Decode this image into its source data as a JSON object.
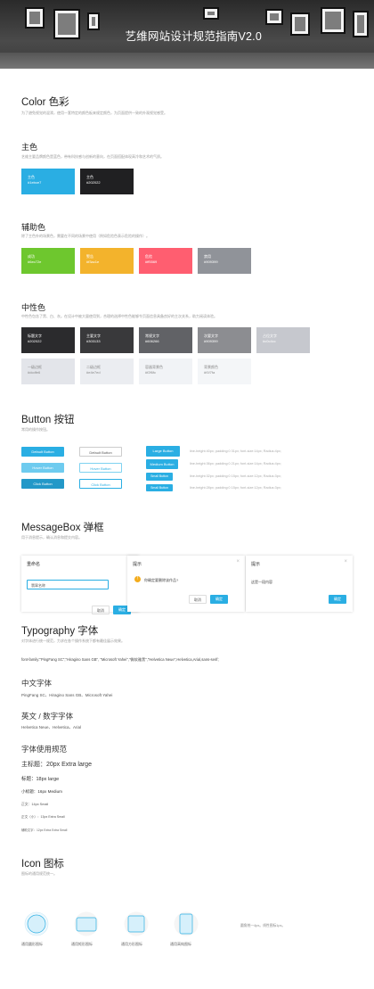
{
  "hero": {
    "title": "艺维网站设计规范指南V2.0"
  },
  "color": {
    "title": "Color 色彩",
    "desc": "为了避免视觉的混淆，使用一套特定的颜色板来规定颜色，为页面提供一致的外观视觉感受。"
  },
  "main": {
    "title": "主色",
    "desc": "艺维主要品牌颜色是蓝色，带有科技感与创新的意向，在页面搭配体现高冷和艺术的气质。",
    "swatches": [
      {
        "name": "主色",
        "hex": "#1ebce7",
        "color": "#2aaee3"
      },
      {
        "name": "主色",
        "hex": "#202022",
        "color": "#202022"
      }
    ]
  },
  "aux": {
    "title": "辅助色",
    "desc": "除了主色外的场景色，需要在不同的场景中使用（例如危险色表示危险的操作）。",
    "swatches": [
      {
        "name": "成功",
        "hex": "#6ec72e",
        "color": "#6ec72e"
      },
      {
        "name": "警告",
        "hex": "#f3ac1e",
        "color": "#f3b32c"
      },
      {
        "name": "危险",
        "hex": "#ff5569",
        "color": "#ff5e70"
      },
      {
        "name": "禁用",
        "hex": "#909399",
        "color": "#909399"
      }
    ]
  },
  "neutral": {
    "title": "中性色",
    "desc": "中性色包含了黑、白、灰。在设计中被大量使用到，合理的选择中性色能够令页面信息具备良好的主次关系，助力阅读体验。",
    "row1": [
      {
        "name": "标题文字",
        "hex": "#202022",
        "color": "#2b2b2d",
        "text": "#fff"
      },
      {
        "name": "主要文字",
        "hex": "#303133",
        "color": "#39393b",
        "text": "#fff"
      },
      {
        "name": "常规文字",
        "hex": "#606266",
        "color": "#616266",
        "text": "#fff"
      },
      {
        "name": "次要文字",
        "hex": "#909399",
        "color": "#8c8d91",
        "text": "#fff"
      },
      {
        "name": "占位文字",
        "hex": "#c0c4cc",
        "color": "#c6c8ce",
        "text": "#fff"
      }
    ],
    "row2": [
      {
        "name": "一级边框",
        "hex": "#dcdfe6",
        "color": "#e3e5ea",
        "text": "#888"
      },
      {
        "name": "二级边框",
        "hex": "#e4e7ed",
        "color": "#ebedf1",
        "text": "#888"
      },
      {
        "name": "容器背景色",
        "hex": "#f2f6fc",
        "color": "#f1f3f6",
        "text": "#888"
      },
      {
        "name": "背景颜色",
        "hex": "#f1f7fa",
        "color": "#f4f6f8",
        "text": "#888"
      }
    ]
  },
  "button": {
    "title": "Button 按钮",
    "desc": "常用的操作按钮。",
    "states": [
      "Default Button",
      "Hover Button",
      "Click Button"
    ],
    "sizes": [
      {
        "label": "Large Button",
        "spec": "line-height:40px;  padding:0 31px;  font-size:14px;  Radius:4px;"
      },
      {
        "label": "Medium Button",
        "spec": "line-height:36px;  padding:0 21px;  font-size:14px;  Radius:4px;"
      },
      {
        "label": "Small Button",
        "spec": "line-height:32px;  padding:0 15px;  font-size:12px;  Radius:3px;"
      },
      {
        "label": "Small Button",
        "spec": "line-height:28px;  padding:0 15px;  font-size:12px;  Radius:3px;"
      }
    ]
  },
  "msg": {
    "title": "MessageBox 弹框",
    "desc": "用于消息提示，确认消息和提交内容。",
    "d1": {
      "title": "重命名",
      "input": "翡翠名称",
      "cancel": "取消",
      "ok": "确定"
    },
    "d2": {
      "title": "提示",
      "body": "你确定要删除该作品?",
      "cancel": "取消",
      "ok": "确定"
    },
    "d3": {
      "title": "提示",
      "body": "这是一段内容",
      "ok": "确定"
    }
  },
  "typo": {
    "title": "Typography 字体",
    "desc": "对字体进行统一规范，力求在各个操作系统下都有最佳展示效果。",
    "stack": "font-family:\"PingFang SC\",\"Hiragino Sans GB\", \"Microsoft Yahei\",\"微软雅黑\",\"Helvetica Neue\",Helvetica,Arial,sans-serif;",
    "cn_title": "中文字体",
    "cn_fonts": "PingFang SC、Hiragino Sans GB、Microsoft Yahei",
    "en_title": "英文 / 数字字体",
    "en_fonts": "Helvetica Neue、Helvetica、Arial",
    "use_title": "字体使用规范",
    "levels": [
      "主标题：20px Extra large",
      "标题：18px large",
      "小标题：16px Medium",
      "正文：14px Small",
      "正文（小）：13px Extra Small",
      "辅助文字：12px Extra Extra Small"
    ]
  },
  "icon": {
    "title": "Icon 图标",
    "desc": "图标的通用规范统一。",
    "labels": [
      "通用圆形图标",
      "通用矩形图标",
      "通用方形图标",
      "通用高纯图标"
    ],
    "note": "圆角统一4px。线性图标1px。"
  }
}
